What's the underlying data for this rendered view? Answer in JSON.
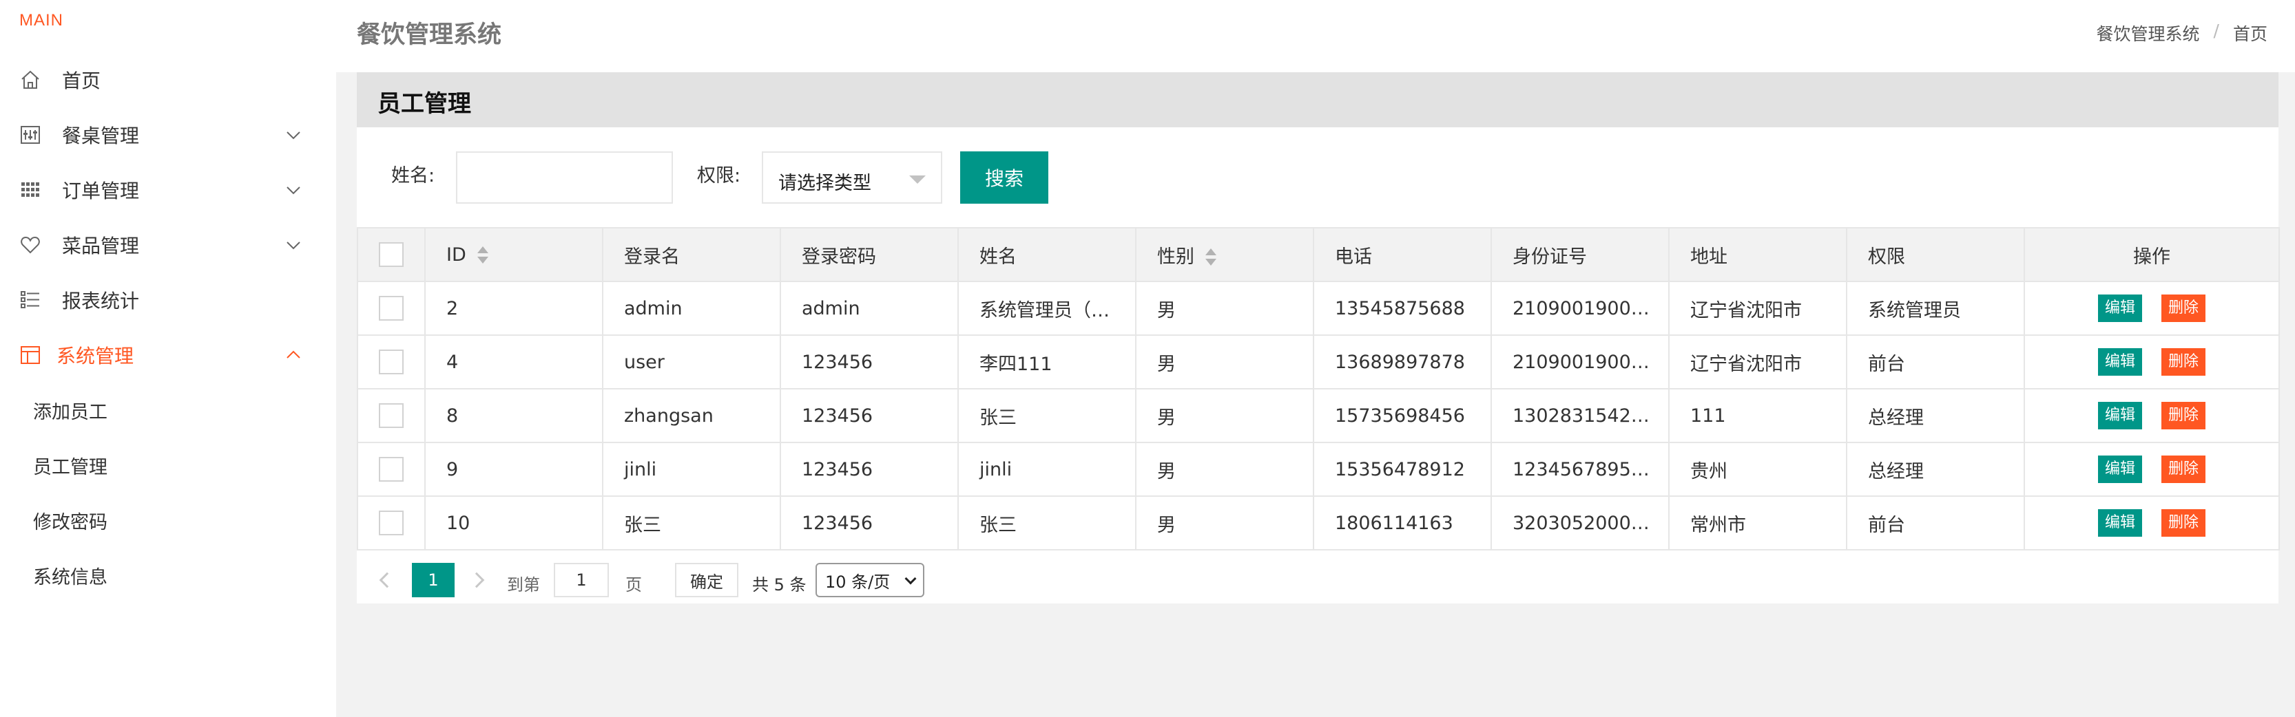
{
  "sidebar": {
    "brand": "MAIN",
    "items": [
      {
        "label": "首页"
      },
      {
        "label": "餐桌管理"
      },
      {
        "label": "订单管理"
      },
      {
        "label": "菜品管理"
      },
      {
        "label": "报表统计"
      },
      {
        "label": "系统管理"
      }
    ],
    "sub_items": [
      {
        "label": "添加员工"
      },
      {
        "label": "员工管理"
      },
      {
        "label": "修改密码"
      },
      {
        "label": "系统信息"
      }
    ]
  },
  "header": {
    "app_title": "餐饮管理系统",
    "breadcrumb": [
      "餐饮管理系统",
      "/",
      "首页"
    ]
  },
  "card": {
    "title": "员工管理"
  },
  "search": {
    "name_label": "姓名:",
    "name_value": "",
    "role_label": "权限:",
    "role_placeholder": "请选择类型",
    "button": "搜索"
  },
  "table": {
    "columns": [
      "ID",
      "登录名",
      "登录密码",
      "姓名",
      "性别",
      "电话",
      "身份证号",
      "地址",
      "权限",
      "操作"
    ],
    "rows": [
      [
        "2",
        "admin",
        "admin",
        "系统管理员（…",
        "男",
        "13545875688",
        "2109001900…",
        "辽宁省沈阳市",
        "系统管理员"
      ],
      [
        "4",
        "user",
        "123456",
        "李四111",
        "男",
        "13689897878",
        "2109001900…",
        "辽宁省沈阳市",
        "前台"
      ],
      [
        "8",
        "zhangsan",
        "123456",
        "张三",
        "男",
        "15735698456",
        "1302831542…",
        "111",
        "总经理"
      ],
      [
        "9",
        "jinli",
        "123456",
        "jinli",
        "男",
        "15356478912",
        "1234567895…",
        "贵州",
        "总经理"
      ],
      [
        "10",
        "张三",
        "123456",
        "张三",
        "男",
        "1806114163",
        "3203052000…",
        "常州市",
        "前台"
      ]
    ],
    "edit_label": "编辑",
    "delete_label": "删除"
  },
  "pagination": {
    "current_page": "1",
    "goto_label": "到第",
    "goto_value": "1",
    "page_label": "页",
    "confirm_label": "确定",
    "total_label": "共 5 条",
    "page_size": "10 条/页"
  },
  "colors": {
    "accent_orange": "#ff5722",
    "primary_green": "#009688"
  }
}
